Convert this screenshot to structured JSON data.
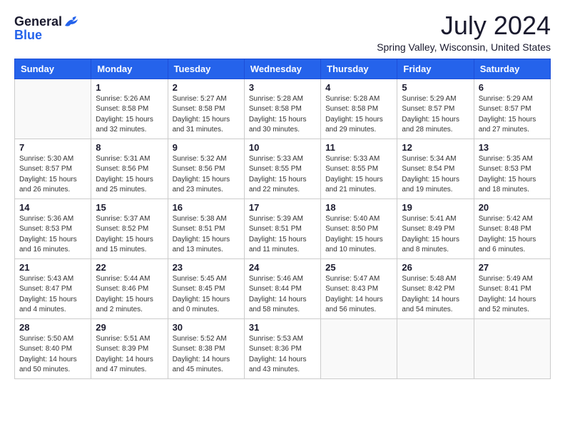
{
  "logo": {
    "general": "General",
    "blue": "Blue"
  },
  "title": "July 2024",
  "location": "Spring Valley, Wisconsin, United States",
  "weekdays": [
    "Sunday",
    "Monday",
    "Tuesday",
    "Wednesday",
    "Thursday",
    "Friday",
    "Saturday"
  ],
  "weeks": [
    [
      {
        "day": "",
        "sunrise": "",
        "sunset": "",
        "daylight": ""
      },
      {
        "day": "1",
        "sunrise": "Sunrise: 5:26 AM",
        "sunset": "Sunset: 8:58 PM",
        "daylight": "Daylight: 15 hours and 32 minutes."
      },
      {
        "day": "2",
        "sunrise": "Sunrise: 5:27 AM",
        "sunset": "Sunset: 8:58 PM",
        "daylight": "Daylight: 15 hours and 31 minutes."
      },
      {
        "day": "3",
        "sunrise": "Sunrise: 5:28 AM",
        "sunset": "Sunset: 8:58 PM",
        "daylight": "Daylight: 15 hours and 30 minutes."
      },
      {
        "day": "4",
        "sunrise": "Sunrise: 5:28 AM",
        "sunset": "Sunset: 8:58 PM",
        "daylight": "Daylight: 15 hours and 29 minutes."
      },
      {
        "day": "5",
        "sunrise": "Sunrise: 5:29 AM",
        "sunset": "Sunset: 8:57 PM",
        "daylight": "Daylight: 15 hours and 28 minutes."
      },
      {
        "day": "6",
        "sunrise": "Sunrise: 5:29 AM",
        "sunset": "Sunset: 8:57 PM",
        "daylight": "Daylight: 15 hours and 27 minutes."
      }
    ],
    [
      {
        "day": "7",
        "sunrise": "Sunrise: 5:30 AM",
        "sunset": "Sunset: 8:57 PM",
        "daylight": "Daylight: 15 hours and 26 minutes."
      },
      {
        "day": "8",
        "sunrise": "Sunrise: 5:31 AM",
        "sunset": "Sunset: 8:56 PM",
        "daylight": "Daylight: 15 hours and 25 minutes."
      },
      {
        "day": "9",
        "sunrise": "Sunrise: 5:32 AM",
        "sunset": "Sunset: 8:56 PM",
        "daylight": "Daylight: 15 hours and 23 minutes."
      },
      {
        "day": "10",
        "sunrise": "Sunrise: 5:33 AM",
        "sunset": "Sunset: 8:55 PM",
        "daylight": "Daylight: 15 hours and 22 minutes."
      },
      {
        "day": "11",
        "sunrise": "Sunrise: 5:33 AM",
        "sunset": "Sunset: 8:55 PM",
        "daylight": "Daylight: 15 hours and 21 minutes."
      },
      {
        "day": "12",
        "sunrise": "Sunrise: 5:34 AM",
        "sunset": "Sunset: 8:54 PM",
        "daylight": "Daylight: 15 hours and 19 minutes."
      },
      {
        "day": "13",
        "sunrise": "Sunrise: 5:35 AM",
        "sunset": "Sunset: 8:53 PM",
        "daylight": "Daylight: 15 hours and 18 minutes."
      }
    ],
    [
      {
        "day": "14",
        "sunrise": "Sunrise: 5:36 AM",
        "sunset": "Sunset: 8:53 PM",
        "daylight": "Daylight: 15 hours and 16 minutes."
      },
      {
        "day": "15",
        "sunrise": "Sunrise: 5:37 AM",
        "sunset": "Sunset: 8:52 PM",
        "daylight": "Daylight: 15 hours and 15 minutes."
      },
      {
        "day": "16",
        "sunrise": "Sunrise: 5:38 AM",
        "sunset": "Sunset: 8:51 PM",
        "daylight": "Daylight: 15 hours and 13 minutes."
      },
      {
        "day": "17",
        "sunrise": "Sunrise: 5:39 AM",
        "sunset": "Sunset: 8:51 PM",
        "daylight": "Daylight: 15 hours and 11 minutes."
      },
      {
        "day": "18",
        "sunrise": "Sunrise: 5:40 AM",
        "sunset": "Sunset: 8:50 PM",
        "daylight": "Daylight: 15 hours and 10 minutes."
      },
      {
        "day": "19",
        "sunrise": "Sunrise: 5:41 AM",
        "sunset": "Sunset: 8:49 PM",
        "daylight": "Daylight: 15 hours and 8 minutes."
      },
      {
        "day": "20",
        "sunrise": "Sunrise: 5:42 AM",
        "sunset": "Sunset: 8:48 PM",
        "daylight": "Daylight: 15 hours and 6 minutes."
      }
    ],
    [
      {
        "day": "21",
        "sunrise": "Sunrise: 5:43 AM",
        "sunset": "Sunset: 8:47 PM",
        "daylight": "Daylight: 15 hours and 4 minutes."
      },
      {
        "day": "22",
        "sunrise": "Sunrise: 5:44 AM",
        "sunset": "Sunset: 8:46 PM",
        "daylight": "Daylight: 15 hours and 2 minutes."
      },
      {
        "day": "23",
        "sunrise": "Sunrise: 5:45 AM",
        "sunset": "Sunset: 8:45 PM",
        "daylight": "Daylight: 15 hours and 0 minutes."
      },
      {
        "day": "24",
        "sunrise": "Sunrise: 5:46 AM",
        "sunset": "Sunset: 8:44 PM",
        "daylight": "Daylight: 14 hours and 58 minutes."
      },
      {
        "day": "25",
        "sunrise": "Sunrise: 5:47 AM",
        "sunset": "Sunset: 8:43 PM",
        "daylight": "Daylight: 14 hours and 56 minutes."
      },
      {
        "day": "26",
        "sunrise": "Sunrise: 5:48 AM",
        "sunset": "Sunset: 8:42 PM",
        "daylight": "Daylight: 14 hours and 54 minutes."
      },
      {
        "day": "27",
        "sunrise": "Sunrise: 5:49 AM",
        "sunset": "Sunset: 8:41 PM",
        "daylight": "Daylight: 14 hours and 52 minutes."
      }
    ],
    [
      {
        "day": "28",
        "sunrise": "Sunrise: 5:50 AM",
        "sunset": "Sunset: 8:40 PM",
        "daylight": "Daylight: 14 hours and 50 minutes."
      },
      {
        "day": "29",
        "sunrise": "Sunrise: 5:51 AM",
        "sunset": "Sunset: 8:39 PM",
        "daylight": "Daylight: 14 hours and 47 minutes."
      },
      {
        "day": "30",
        "sunrise": "Sunrise: 5:52 AM",
        "sunset": "Sunset: 8:38 PM",
        "daylight": "Daylight: 14 hours and 45 minutes."
      },
      {
        "day": "31",
        "sunrise": "Sunrise: 5:53 AM",
        "sunset": "Sunset: 8:36 PM",
        "daylight": "Daylight: 14 hours and 43 minutes."
      },
      {
        "day": "",
        "sunrise": "",
        "sunset": "",
        "daylight": ""
      },
      {
        "day": "",
        "sunrise": "",
        "sunset": "",
        "daylight": ""
      },
      {
        "day": "",
        "sunrise": "",
        "sunset": "",
        "daylight": ""
      }
    ]
  ]
}
